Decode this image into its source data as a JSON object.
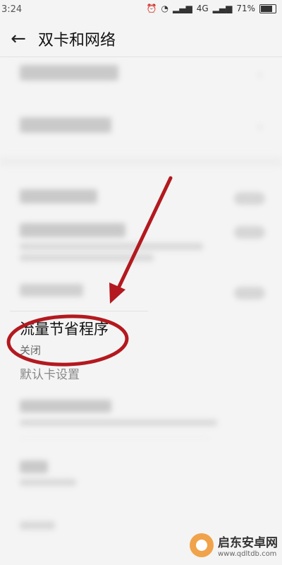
{
  "status_bar": {
    "time": "3:24",
    "network": "4G",
    "battery": "71%"
  },
  "header": {
    "title": "双卡和网络"
  },
  "highlighted_item": {
    "title": "流量节省程序",
    "status": "关闭"
  },
  "section": {
    "default_card": "默认卡设置"
  },
  "watermark": {
    "name": "启东安卓网",
    "url": "www.qdltdb.com"
  },
  "colors": {
    "annotation": "#b3191f",
    "watermark_logo": "#f0a34a"
  }
}
